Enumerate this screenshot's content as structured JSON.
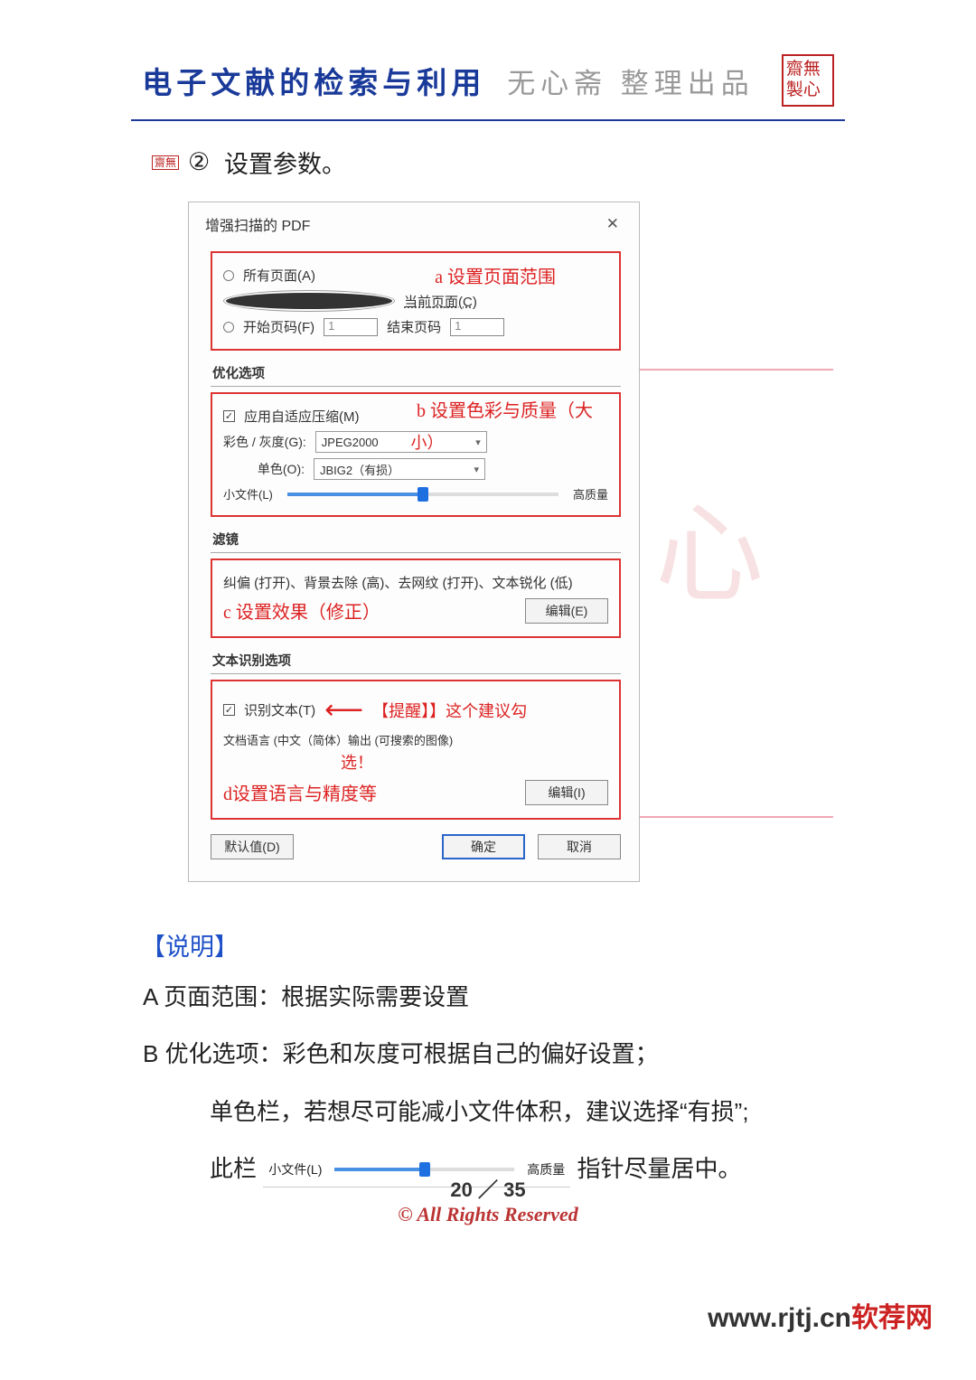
{
  "header": {
    "title": "电子文献的检索与利用",
    "subtitle": "无心斋 整理出品",
    "seal": "齋無製心"
  },
  "step": {
    "icon": "齋無",
    "num": "②",
    "text": "设置参数。"
  },
  "dialog": {
    "title": "增强扫描的 PDF",
    "close": "✕",
    "range": {
      "all": "所有页面(A)",
      "current": "当前页面(C)",
      "from": "开始页码(F)",
      "to_lbl": "结束页码",
      "from_v": "1",
      "to_v": "1",
      "annot": "a 设置页面范围"
    },
    "opt": {
      "hd": "优化选项",
      "adaptive": "应用自适应压缩(M)",
      "color_lbl": "彩色 / 灰度(G):",
      "color_v": "JPEG2000",
      "mono_lbl": "单色(O):",
      "mono_v": "JBIG2（有损）",
      "small": "小文件(L)",
      "high": "高质量",
      "annot_b": "b 设置色彩与质量（大",
      "annot_b2": "小）"
    },
    "filter": {
      "hd": "滤镜",
      "desc": "纠偏 (打开)、背景去除 (高)、去网纹 (打开)、文本锐化 (低)",
      "annot": "c 设置效果（修正）",
      "edit": "编辑(E)"
    },
    "ocr": {
      "hd": "文本识别选项",
      "ck": "识别文本(T)",
      "lang": "文档语言 (中文（简体）输出 (可搜索的图像)",
      "tip": "【提醒】】这个建议勾",
      "tip2": "选！",
      "annot": "d设置语言与精度等",
      "edit": "编辑(I)"
    },
    "btns": {
      "def": "默认值(D)",
      "ok": "确定",
      "cancel": "取消"
    }
  },
  "notes": {
    "hd": "【说明】",
    "a": "A 页面范围：根据实际需要设置",
    "b": "B 优化选项：彩色和灰度可根据自己的偏好设置；",
    "b2_pre": "单色栏，若想尽可能减小文件体积，建议选择“有损”;",
    "b3_pre": "此栏",
    "b3_post": " 指针尽量居中。",
    "sl_small": "小文件(L)",
    "sl_high": "高质量"
  },
  "footer": {
    "page": "20 ／ 35",
    "rights": "© All Rights Reserved"
  },
  "brand": {
    "a": "www.rjtj.cn",
    "b": "软荐网"
  },
  "watermark": "齋無製心"
}
